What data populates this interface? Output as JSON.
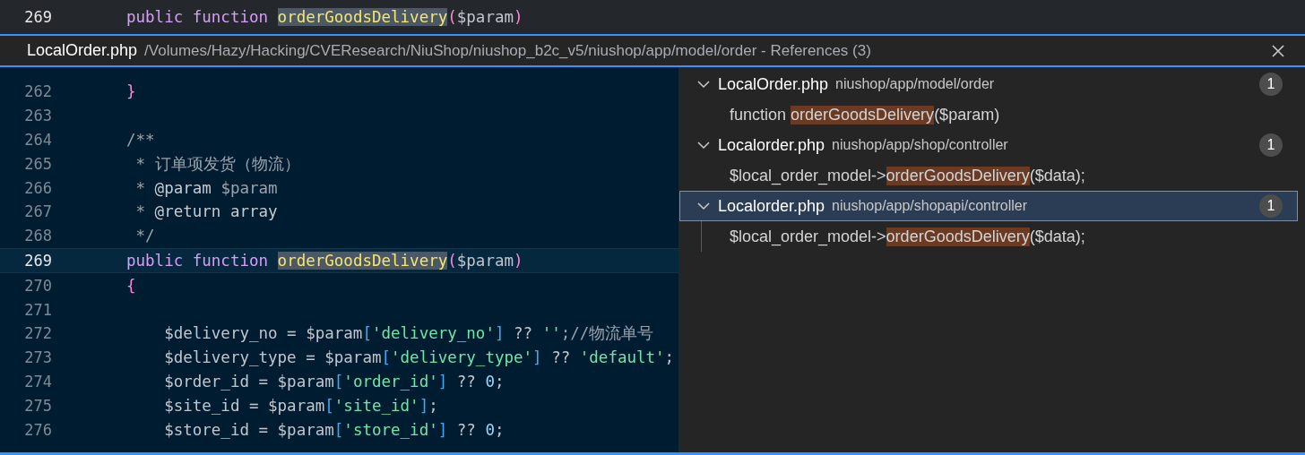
{
  "current_line": {
    "number": "269",
    "tokens": [
      {
        "text": "public ",
        "kind": "keyword"
      },
      {
        "text": "function ",
        "kind": "keyword"
      },
      {
        "text": "orderGoodsDelivery",
        "kind": "function",
        "highlighted": true
      },
      {
        "text": "(",
        "kind": "paren"
      },
      {
        "text": "$param",
        "kind": "variable"
      },
      {
        "text": ")",
        "kind": "paren"
      }
    ]
  },
  "peek": {
    "file": "LocalOrder.php",
    "path": "/Volumes/Hazy/Hacking/CVEResearch/NiuShop/niushop_b2c_v5/niushop/app/model/order",
    "title_suffix": " - References (3)"
  },
  "editor_lines": [
    {
      "number": "262",
      "current": false,
      "tokens": [
        {
          "text": "}",
          "kind": "paren"
        }
      ]
    },
    {
      "number": "263",
      "current": false
    },
    {
      "number": "264",
      "current": false,
      "tokens": [
        {
          "text": "/**",
          "kind": "comment"
        }
      ]
    },
    {
      "number": "265",
      "current": false,
      "tokens": [
        {
          "text": " * 订单项发货（物流）",
          "kind": "comment"
        }
      ]
    },
    {
      "number": "266",
      "current": false,
      "tokens": [
        {
          "text": " * ",
          "kind": "comment"
        },
        {
          "text": "@param ",
          "kind": "doctag"
        },
        {
          "text": "$param",
          "kind": "comment"
        }
      ]
    },
    {
      "number": "267",
      "current": false,
      "tokens": [
        {
          "text": " * ",
          "kind": "comment"
        },
        {
          "text": "@return array",
          "kind": "doctag"
        }
      ]
    },
    {
      "number": "268",
      "current": false,
      "tokens": [
        {
          "text": " */",
          "kind": "comment"
        }
      ]
    },
    {
      "number": "269",
      "current": true,
      "tokens": [
        {
          "text": "public ",
          "kind": "keyword"
        },
        {
          "text": "function ",
          "kind": "keyword"
        },
        {
          "text": "orderGoodsDelivery",
          "kind": "function",
          "highlighted": true
        },
        {
          "text": "(",
          "kind": "paren"
        },
        {
          "text": "$param",
          "kind": "variable"
        },
        {
          "text": ")",
          "kind": "paren"
        }
      ]
    },
    {
      "number": "270",
      "current": false,
      "tokens": [
        {
          "text": "{",
          "kind": "paren"
        }
      ]
    },
    {
      "number": "271",
      "current": false
    },
    {
      "number": "272",
      "current": false,
      "tokens": [
        {
          "text": "    $delivery_no = $param",
          "kind": "variable"
        },
        {
          "text": "[",
          "kind": "bracket"
        },
        {
          "text": "'delivery_no'",
          "kind": "string"
        },
        {
          "text": "]",
          "kind": "bracket"
        },
        {
          "text": " ?? ",
          "kind": "variable"
        },
        {
          "text": "''",
          "kind": "string"
        },
        {
          "text": ";//物流单号",
          "kind": "comment"
        }
      ]
    },
    {
      "number": "273",
      "current": false,
      "tokens": [
        {
          "text": "    $delivery_type = $param",
          "kind": "variable"
        },
        {
          "text": "[",
          "kind": "bracket"
        },
        {
          "text": "'delivery_type'",
          "kind": "string"
        },
        {
          "text": "]",
          "kind": "bracket"
        },
        {
          "text": " ?? ",
          "kind": "variable"
        },
        {
          "text": "'default'",
          "kind": "string"
        },
        {
          "text": ";",
          "kind": "variable"
        }
      ]
    },
    {
      "number": "274",
      "current": false,
      "tokens": [
        {
          "text": "    $order_id = $param",
          "kind": "variable"
        },
        {
          "text": "[",
          "kind": "bracket"
        },
        {
          "text": "'order_id'",
          "kind": "string"
        },
        {
          "text": "]",
          "kind": "bracket"
        },
        {
          "text": " ?? ",
          "kind": "variable"
        },
        {
          "text": "0",
          "kind": "number"
        },
        {
          "text": ";",
          "kind": "variable"
        }
      ]
    },
    {
      "number": "275",
      "current": false,
      "tokens": [
        {
          "text": "    $site_id = $param",
          "kind": "variable"
        },
        {
          "text": "[",
          "kind": "bracket"
        },
        {
          "text": "'site_id'",
          "kind": "string"
        },
        {
          "text": "]",
          "kind": "bracket"
        },
        {
          "text": ";",
          "kind": "variable"
        }
      ]
    },
    {
      "number": "276",
      "current": false,
      "tokens": [
        {
          "text": "    $store_id = $param",
          "kind": "variable"
        },
        {
          "text": "[",
          "kind": "bracket"
        },
        {
          "text": "'store_id'",
          "kind": "string"
        },
        {
          "text": "]",
          "kind": "bracket"
        },
        {
          "text": " ?? ",
          "kind": "variable"
        },
        {
          "text": "0",
          "kind": "number"
        },
        {
          "text": ";",
          "kind": "variable"
        }
      ]
    }
  ],
  "references": [
    {
      "file": "LocalOrder.php",
      "path": "niushop/app/model/order",
      "count": "1",
      "expanded": true,
      "selected": false,
      "matches": [
        {
          "before": "function ",
          "match": "orderGoodsDelivery",
          "after": "($param)"
        }
      ]
    },
    {
      "file": "Localorder.php",
      "path": "niushop/app/shop/controller",
      "count": "1",
      "expanded": true,
      "selected": false,
      "matches": [
        {
          "before": "$local_order_model->",
          "match": "orderGoodsDelivery",
          "after": "($data);"
        }
      ]
    },
    {
      "file": "Localorder.php",
      "path": "niushop/app/shopapi/controller",
      "count": "1",
      "expanded": true,
      "selected": true,
      "matches": [
        {
          "before": "$local_order_model->",
          "match": "orderGoodsDelivery",
          "after": "($data);"
        }
      ]
    }
  ]
}
